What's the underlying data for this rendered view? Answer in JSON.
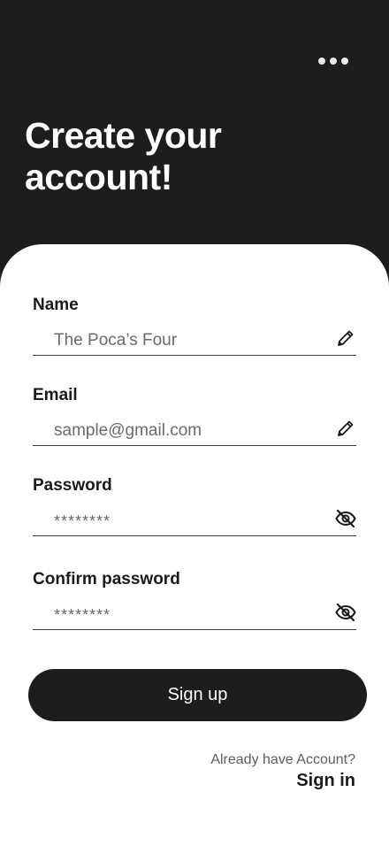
{
  "header": {
    "title_line1": "Create your",
    "title_line2": "account!",
    "menu_icon": "more-horizontal-icon"
  },
  "form": {
    "name": {
      "label": "Name",
      "value": "The Poca’s Four",
      "icon": "pencil-icon"
    },
    "email": {
      "label": "Email",
      "value": "sample@gmail.com",
      "icon": "pencil-icon"
    },
    "password": {
      "label": "Password",
      "value": "********",
      "icon": "eye-off-icon"
    },
    "confirm_password": {
      "label": "Confirm password",
      "value": "********",
      "icon": "eye-off-icon"
    },
    "submit_label": "Sign up"
  },
  "footer": {
    "prompt": "Already have Account?",
    "link_label": "Sign in"
  },
  "colors": {
    "background_dark": "#1d1d1d",
    "card": "#ffffff",
    "text_primary": "#1b1b1b",
    "text_muted": "#6b6b6b"
  }
}
